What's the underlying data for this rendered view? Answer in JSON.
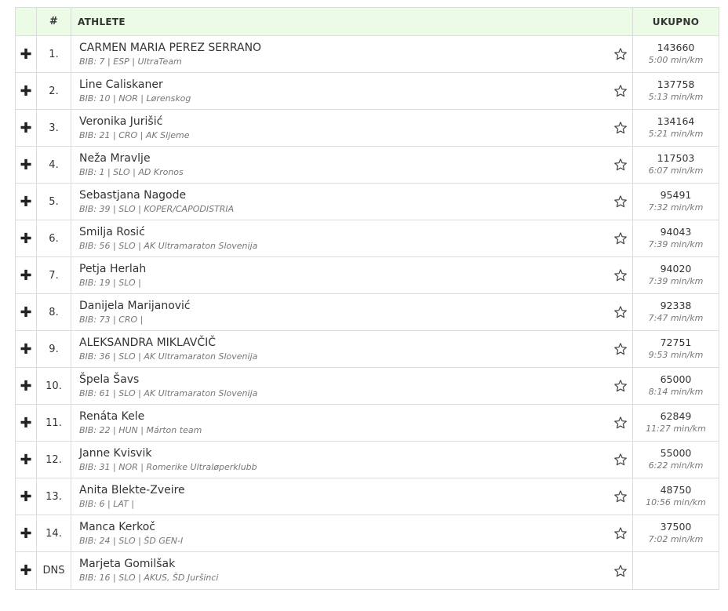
{
  "header": {
    "expand": "",
    "rank": "#",
    "athlete": "ATHLETE",
    "total": "UKUPNO"
  },
  "rows": [
    {
      "rank": "1.",
      "name": "CARMEN MARIA PEREZ SERRANO",
      "meta": "BIB: 7 | ESP | UltraTeam",
      "score": "143660",
      "pace": "5:00 min/km"
    },
    {
      "rank": "2.",
      "name": "Line Caliskaner",
      "meta": "BIB: 10 | NOR | Lørenskog",
      "score": "137758",
      "pace": "5:13 min/km"
    },
    {
      "rank": "3.",
      "name": "Veronika Jurišić",
      "meta": "BIB: 21 | CRO | AK Sljeme",
      "score": "134164",
      "pace": "5:21 min/km"
    },
    {
      "rank": "4.",
      "name": "Neža Mravlje",
      "meta": "BIB: 1 | SLO | AD Kronos",
      "score": "117503",
      "pace": "6:07 min/km"
    },
    {
      "rank": "5.",
      "name": "Sebastjana Nagode",
      "meta": "BIB: 39 | SLO | KOPER/CAPODISTRIA",
      "score": "95491",
      "pace": "7:32 min/km"
    },
    {
      "rank": "6.",
      "name": "Smilja Rosić",
      "meta": "BIB: 56 | SLO | AK Ultramaraton Slovenija",
      "score": "94043",
      "pace": "7:39 min/km"
    },
    {
      "rank": "7.",
      "name": "Petja Herlah",
      "meta": "BIB: 19 | SLO |",
      "score": "94020",
      "pace": "7:39 min/km"
    },
    {
      "rank": "8.",
      "name": "Danijela Marijanović",
      "meta": "BIB: 73 | CRO |",
      "score": "92338",
      "pace": "7:47 min/km"
    },
    {
      "rank": "9.",
      "name": "ALEKSANDRA MIKLAVČIČ",
      "meta": "BIB: 36 | SLO | AK Ultramaraton Slovenija",
      "score": "72751",
      "pace": "9:53 min/km"
    },
    {
      "rank": "10.",
      "name": "Špela Šavs",
      "meta": "BIB: 61 | SLO | AK Ultramaraton Slovenija",
      "score": "65000",
      "pace": "8:14 min/km"
    },
    {
      "rank": "11.",
      "name": "Renáta Kele",
      "meta": "BIB: 22 | HUN | Márton team",
      "score": "62849",
      "pace": "11:27 min/km"
    },
    {
      "rank": "12.",
      "name": "Janne Kvisvik",
      "meta": "BIB: 31 | NOR | Romerike Ultraløperklubb",
      "score": "55000",
      "pace": "6:22 min/km"
    },
    {
      "rank": "13.",
      "name": "Anita Blekte-Zveire",
      "meta": "BIB: 6 | LAT |",
      "score": "48750",
      "pace": "10:56 min/km"
    },
    {
      "rank": "14.",
      "name": "Manca Kerkoč",
      "meta": "BIB: 24 | SLO | ŠD GEN-I",
      "score": "37500",
      "pace": "7:02 min/km"
    },
    {
      "rank": "DNS",
      "name": "Marjeta Gomilšak",
      "meta": "BIB: 16 | SLO | AKUS, ŠD Juršinci",
      "score": "",
      "pace": ""
    }
  ],
  "icons": {
    "expand": "plus-icon",
    "favorite": "star-outline-icon"
  },
  "colors": {
    "header_bg": "#ebfbe5",
    "border": "#dcdcdc",
    "text": "#333333",
    "muted": "#777777"
  }
}
